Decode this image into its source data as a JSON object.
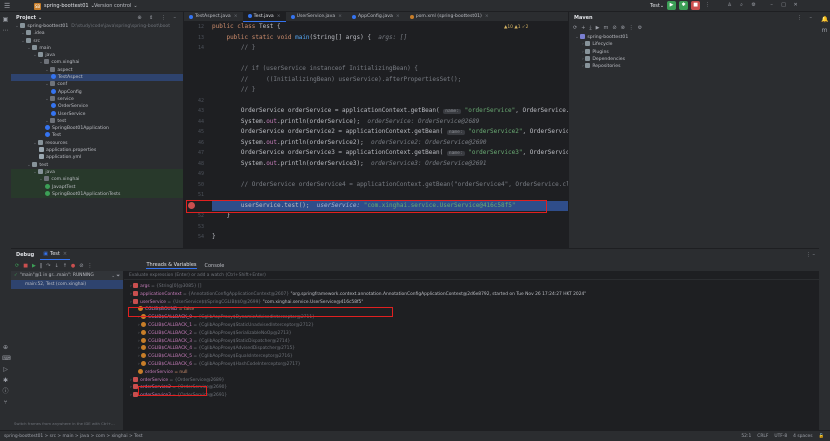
{
  "titlebar": {
    "project_badge": "SB",
    "project_name": "spring-boottest01",
    "version_control": "Version control",
    "run_config": "Test"
  },
  "project": {
    "title": "Project",
    "items": [
      {
        "label": "spring-boottest01",
        "path": "D:\\study\\code\\java\\spring\\spring-boot\\boot",
        "indent": 0,
        "icon": "folder"
      },
      {
        "label": ".idea",
        "indent": 1,
        "icon": "folder"
      },
      {
        "label": "src",
        "indent": 1,
        "icon": "folder"
      },
      {
        "label": "main",
        "indent": 2,
        "icon": "folder"
      },
      {
        "label": "java",
        "indent": 3,
        "icon": "folder"
      },
      {
        "label": "com.xinghai",
        "indent": 4,
        "icon": "pkg"
      },
      {
        "label": "aspect",
        "indent": 5,
        "icon": "pkg"
      },
      {
        "label": "TestAspect",
        "indent": 6,
        "icon": "class",
        "selected": true
      },
      {
        "label": "conf",
        "indent": 5,
        "icon": "pkg"
      },
      {
        "label": "AppConfig",
        "indent": 6,
        "icon": "class"
      },
      {
        "label": "service",
        "indent": 5,
        "icon": "pkg"
      },
      {
        "label": "OrderService",
        "indent": 6,
        "icon": "class"
      },
      {
        "label": "UserService",
        "indent": 6,
        "icon": "class"
      },
      {
        "label": "test",
        "indent": 5,
        "icon": "pkg"
      },
      {
        "label": "SpringBoot01Application",
        "indent": 5,
        "icon": "class"
      },
      {
        "label": "Test",
        "indent": 5,
        "icon": "class"
      },
      {
        "label": "resources",
        "indent": 3,
        "icon": "folder"
      },
      {
        "label": "application.properties",
        "indent": 4,
        "icon": "props"
      },
      {
        "label": "application.yml",
        "indent": 4,
        "icon": "props"
      },
      {
        "label": "test",
        "indent": 2,
        "icon": "folder"
      },
      {
        "label": "java",
        "indent": 3,
        "icon": "folder",
        "test": true
      },
      {
        "label": "com.xinghai",
        "indent": 4,
        "icon": "pkg",
        "test": true
      },
      {
        "label": "JavaptTest",
        "indent": 5,
        "icon": "test",
        "test": true
      },
      {
        "label": "SpringBoot01ApplicationTests",
        "indent": 5,
        "icon": "test",
        "test": true
      }
    ]
  },
  "editor": {
    "tabs": [
      {
        "label": "TestAspect.java",
        "active": false
      },
      {
        "label": "Test.java",
        "active": true
      },
      {
        "label": "UserService.java",
        "active": false
      },
      {
        "label": "AppConfig.java",
        "active": false
      },
      {
        "label": "pom.xml (spring-boottest01)",
        "active": false
      }
    ],
    "inspection": "▲10  ▲1  ✓2",
    "line_numbers": [
      "12",
      "13",
      "14",
      "",
      "",
      "",
      "",
      "42",
      "43",
      "44",
      "45",
      "46",
      "47",
      "48",
      "49",
      "50",
      "51",
      "",
      "52",
      "53",
      "54"
    ]
  },
  "maven": {
    "title": "Maven",
    "items": [
      {
        "label": "spring-boottest01",
        "indent": 0
      },
      {
        "label": "Lifecycle",
        "indent": 1
      },
      {
        "label": "Plugins",
        "indent": 1
      },
      {
        "label": "Dependencies",
        "indent": 1
      },
      {
        "label": "Repositories",
        "indent": 1
      }
    ]
  },
  "debug": {
    "title": "Debug",
    "session_tab": "Test",
    "tabs": [
      "Threads & Variables",
      "Console"
    ],
    "thread": "\"main\"@1 in gr...main\": RUNNING",
    "frame": "main:52, Test (com.xinghai)",
    "eval_placeholder": "Evaluate expression (Enter) or add a watch (Ctrl+Shift+Enter)",
    "hint": "Switch frames from anywhere in the IDE with Ctrl+...",
    "variables": [
      {
        "name": "args",
        "value": "= {String[0]@3085} []",
        "indent": 0,
        "icon": "v"
      },
      {
        "name": "applicationContext",
        "type": "= {AnnotationConfigApplicationContext@2607}",
        "value": "\"org.springframework.context.annotation.AnnotationConfigApplicationContext@2d6e8792, started on Tue Nov 26 17:24:27 HKT 2024\"",
        "indent": 0,
        "icon": "v"
      },
      {
        "name": "userService",
        "type": "= {UserService$$SpringCGLIB$$0@2699}",
        "value": "\"com.xinghai.service.UserService@416c58f5\"",
        "indent": 0,
        "icon": "v"
      },
      {
        "name": "CGLIB$BOUND",
        "value": "= false",
        "indent": 1,
        "icon": "f"
      },
      {
        "name": "CGLIB$CALLBACK_0",
        "value": "= {CglibAopProxy$DynamicAdvisedInterceptor@2711}",
        "indent": 1,
        "icon": "f"
      },
      {
        "name": "CGLIB$CALLBACK_1",
        "value": "= {CglibAopProxy$StaticUnadvisedInterceptor@2712}",
        "indent": 1,
        "icon": "f"
      },
      {
        "name": "CGLIB$CALLBACK_2",
        "value": "= {CglibAopProxy$SerializableNoOp@2713}",
        "indent": 1,
        "icon": "f"
      },
      {
        "name": "CGLIB$CALLBACK_3",
        "value": "= {CglibAopProxy$StaticDispatcher@2714}",
        "indent": 1,
        "icon": "f"
      },
      {
        "name": "CGLIB$CALLBACK_4",
        "value": "= {CglibAopProxy$AdvisedDispatcher@2715}",
        "indent": 1,
        "icon": "f"
      },
      {
        "name": "CGLIB$CALLBACK_5",
        "value": "= {CglibAopProxy$EqualsInterceptor@2716}",
        "indent": 1,
        "icon": "f"
      },
      {
        "name": "CGLIB$CALLBACK_6",
        "value": "= {CglibAopProxy$HashCodeInterceptor@2717}",
        "indent": 1,
        "icon": "f"
      },
      {
        "name": "orderService",
        "value": "= null",
        "indent": 1,
        "icon": "f"
      },
      {
        "name": "orderService",
        "value": "= {OrderService@2689}",
        "indent": 0,
        "icon": "v"
      },
      {
        "name": "orderService2",
        "value": "= {OrderService@2690}",
        "indent": 0,
        "icon": "v"
      },
      {
        "name": "orderService3",
        "value": "= {OrderService@2691}",
        "indent": 0,
        "icon": "v"
      }
    ]
  },
  "status": {
    "breadcrumb": "spring-boottest01 > src > main > java > com > xinghai > Test",
    "position": "52:1",
    "line_sep": "CRLF",
    "encoding": "UTF-8",
    "indent": "4 spaces"
  }
}
